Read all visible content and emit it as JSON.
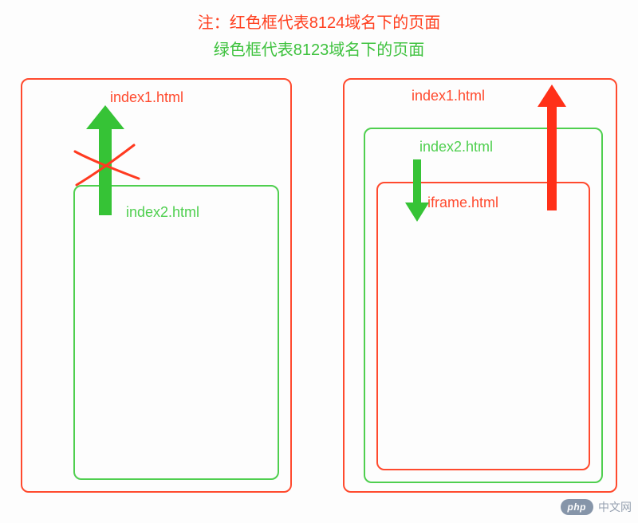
{
  "header": {
    "line1": "注：红色框代表8124域名下的页面",
    "line2": "绿色框代表8123域名下的页面"
  },
  "left": {
    "outer_label": "index1.html",
    "inner_label": "index2.html"
  },
  "right": {
    "outer_label": "index1.html",
    "mid_label": "index2.html",
    "inner_label": "iframe.html"
  },
  "watermark": {
    "badge": "php",
    "text": "中文网"
  },
  "colors": {
    "red": "#ff4a2e",
    "green": "#4fcf4f"
  }
}
